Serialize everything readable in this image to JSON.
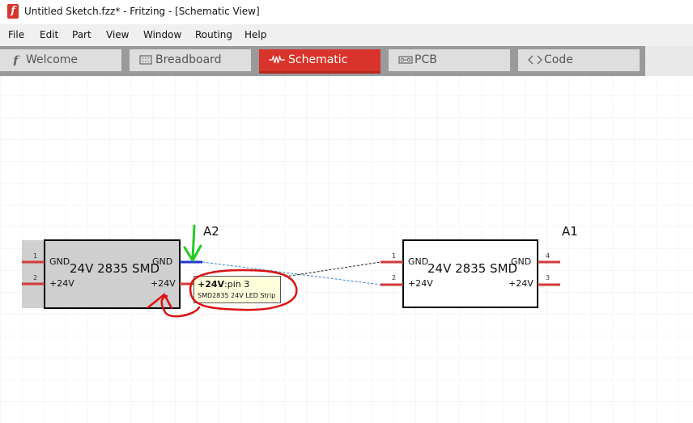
{
  "window": {
    "title": "Untitled Sketch.fzz* - Fritzing - [Schematic View]",
    "app_icon_glyph": "f"
  },
  "menu": [
    "File",
    "Edit",
    "Part",
    "View",
    "Window",
    "Routing",
    "Help"
  ],
  "tabs": [
    {
      "label": "Welcome",
      "icon": "fritzing-f-icon",
      "active": false
    },
    {
      "label": "Breadboard",
      "icon": "breadboard-icon",
      "active": false
    },
    {
      "label": "Schematic",
      "icon": "resistor-icon",
      "active": true
    },
    {
      "label": "PCB",
      "icon": "pcb-icon",
      "active": false
    },
    {
      "label": "Code",
      "icon": "code-brackets-icon",
      "active": false
    }
  ],
  "colors": {
    "accent": "#d9342b",
    "pin_red": "#d23a3a",
    "highlight_blue": "#2233cc",
    "ratsnest_blue": "#3a7fd0",
    "annotation_green": "#22cc22",
    "annotation_red": "#dd1111",
    "tooltip_bg": "#ffffdc"
  },
  "parts": {
    "a2": {
      "ref": "A2",
      "title": "24V 2835 SMD",
      "pins": [
        {
          "num": "1",
          "label": "GND"
        },
        {
          "num": "2",
          "label": "+24V"
        },
        {
          "label": "GND"
        },
        {
          "label": "+24V"
        }
      ]
    },
    "a1": {
      "ref": "A1",
      "title": "24V 2835 SMD",
      "pins": [
        {
          "num": "1",
          "label": "GND"
        },
        {
          "num": "2",
          "label": "+24V"
        },
        {
          "num": "4",
          "label": "GND"
        },
        {
          "num": "3",
          "label": "+24V"
        }
      ]
    }
  },
  "tooltip": {
    "pin_name": "+24V",
    "pin_suffix": ":pin 3",
    "part_desc": "SMD2835 24V LED Strip"
  }
}
